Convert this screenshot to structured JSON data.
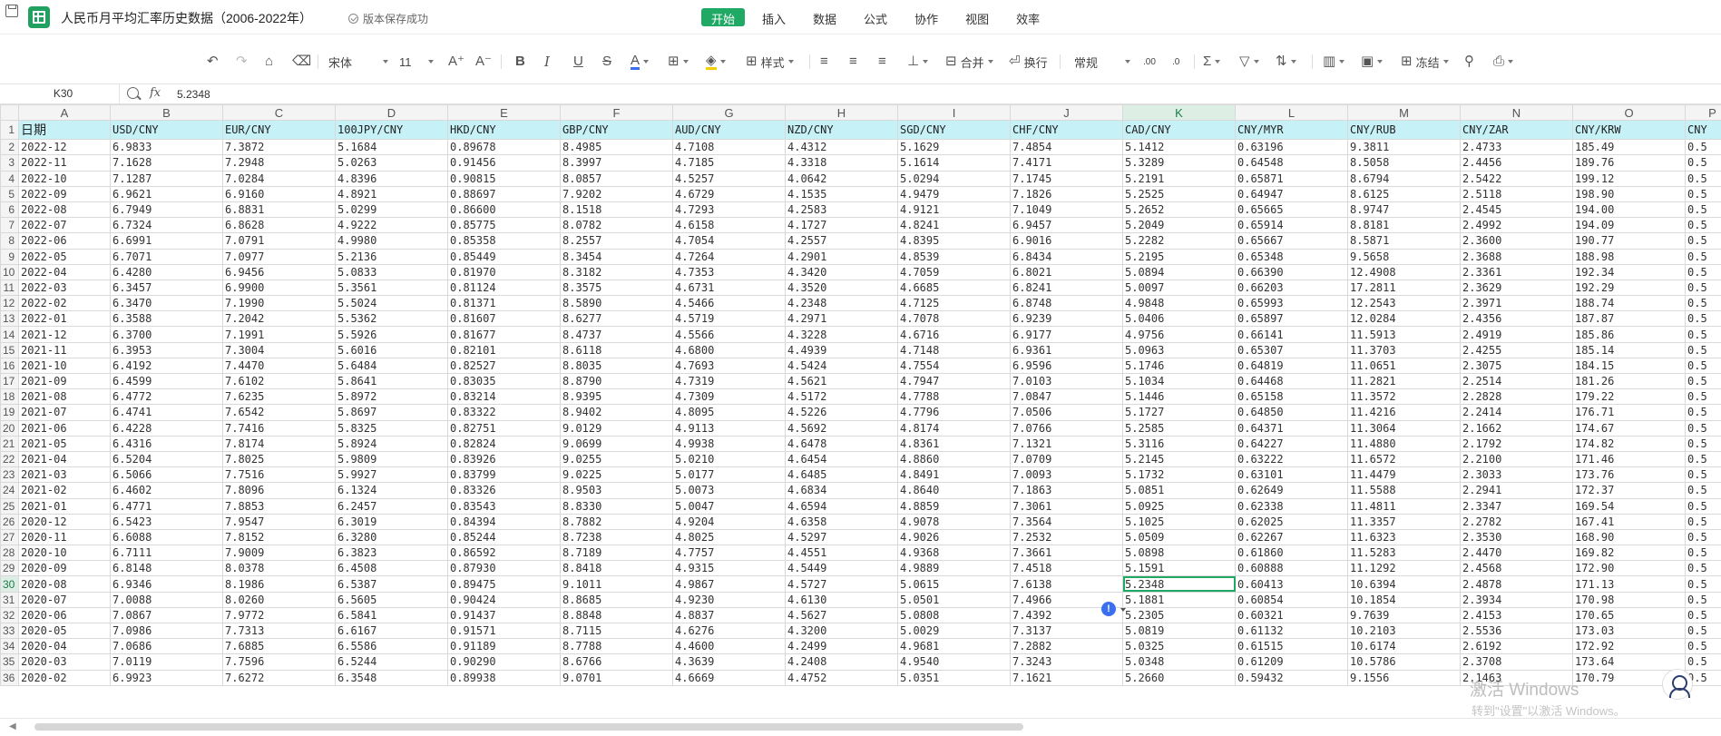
{
  "titlebar": {
    "doc_title": "人民币月平均汇率历史数据（2006-2022年）",
    "save_status": "版本保存成功",
    "menu": [
      "开始",
      "插入",
      "数据",
      "公式",
      "协作",
      "视图",
      "效率"
    ],
    "active_menu": "开始"
  },
  "toolbar": {
    "font_name": "宋体",
    "font_size": "11",
    "style_label": "样式",
    "merge_label": "合并",
    "wrap_label": "换行",
    "number_format": "常规",
    "freeze_label": "冻结",
    "decimal_add": ".00",
    "decimal_remove": ".0"
  },
  "formula": {
    "cell_ref": "K30",
    "fx": "fx",
    "value": "5.2348"
  },
  "grid": {
    "columns": [
      "A",
      "B",
      "C",
      "D",
      "E",
      "F",
      "G",
      "H",
      "I",
      "J",
      "K",
      "L",
      "M",
      "N",
      "O",
      "P"
    ],
    "selected_column": "K",
    "selected_row": 30,
    "active_cell": {
      "row": 30,
      "col": 10
    },
    "header_row": [
      "日期",
      "USD/CNY",
      "EUR/CNY",
      "100JPY/CNY",
      "HKD/CNY",
      "GBP/CNY",
      "AUD/CNY",
      "NZD/CNY",
      "SGD/CNY",
      "CHF/CNY",
      "CAD/CNY",
      "CNY/MYR",
      "CNY/RUB",
      "CNY/ZAR",
      "CNY/KRW",
      "CNY"
    ],
    "rows": [
      [
        "2022-12",
        "6.9833",
        "7.3872",
        "5.1684",
        "0.89678",
        "8.4985",
        "4.7108",
        "4.4312",
        "5.1629",
        "7.4854",
        "5.1412",
        "0.63196",
        "9.3811",
        "2.4733",
        "185.49",
        "0.5"
      ],
      [
        "2022-11",
        "7.1628",
        "7.2948",
        "5.0263",
        "0.91456",
        "8.3997",
        "4.7185",
        "4.3318",
        "5.1614",
        "7.4171",
        "5.3289",
        "0.64548",
        "8.5058",
        "2.4456",
        "189.76",
        "0.5"
      ],
      [
        "2022-10",
        "7.1287",
        "7.0284",
        "4.8396",
        "0.90815",
        "8.0857",
        "4.5257",
        "4.0642",
        "5.0294",
        "7.1745",
        "5.2191",
        "0.65871",
        "8.6794",
        "2.5422",
        "199.12",
        "0.5"
      ],
      [
        "2022-09",
        "6.9621",
        "6.9160",
        "4.8921",
        "0.88697",
        "7.9202",
        "4.6729",
        "4.1535",
        "4.9479",
        "7.1826",
        "5.2525",
        "0.64947",
        "8.6125",
        "2.5118",
        "198.90",
        "0.5"
      ],
      [
        "2022-08",
        "6.7949",
        "6.8831",
        "5.0299",
        "0.86600",
        "8.1518",
        "4.7293",
        "4.2583",
        "4.9121",
        "7.1049",
        "5.2652",
        "0.65665",
        "8.9747",
        "2.4545",
        "194.00",
        "0.5"
      ],
      [
        "2022-07",
        "6.7324",
        "6.8628",
        "4.9222",
        "0.85775",
        "8.0782",
        "4.6158",
        "4.1727",
        "4.8241",
        "6.9457",
        "5.2049",
        "0.65914",
        "8.8181",
        "2.4992",
        "194.09",
        "0.5"
      ],
      [
        "2022-06",
        "6.6991",
        "7.0791",
        "4.9980",
        "0.85358",
        "8.2557",
        "4.7054",
        "4.2557",
        "4.8395",
        "6.9016",
        "5.2282",
        "0.65667",
        "8.5871",
        "2.3600",
        "190.77",
        "0.5"
      ],
      [
        "2022-05",
        "6.7071",
        "7.0977",
        "5.2136",
        "0.85449",
        "8.3454",
        "4.7264",
        "4.2901",
        "4.8539",
        "6.8434",
        "5.2195",
        "0.65348",
        "9.5658",
        "2.3688",
        "188.98",
        "0.5"
      ],
      [
        "2022-04",
        "6.4280",
        "6.9456",
        "5.0833",
        "0.81970",
        "8.3182",
        "4.7353",
        "4.3420",
        "4.7059",
        "6.8021",
        "5.0894",
        "0.66390",
        "12.4908",
        "2.3361",
        "192.34",
        "0.5"
      ],
      [
        "2022-03",
        "6.3457",
        "6.9900",
        "5.3561",
        "0.81124",
        "8.3575",
        "4.6731",
        "4.3520",
        "4.6685",
        "6.8241",
        "5.0097",
        "0.66203",
        "17.2811",
        "2.3629",
        "192.29",
        "0.5"
      ],
      [
        "2022-02",
        "6.3470",
        "7.1990",
        "5.5024",
        "0.81371",
        "8.5890",
        "4.5466",
        "4.2348",
        "4.7125",
        "6.8748",
        "4.9848",
        "0.65993",
        "12.2543",
        "2.3971",
        "188.74",
        "0.5"
      ],
      [
        "2022-01",
        "6.3588",
        "7.2042",
        "5.5362",
        "0.81607",
        "8.6277",
        "4.5719",
        "4.2971",
        "4.7078",
        "6.9239",
        "5.0406",
        "0.65897",
        "12.0284",
        "2.4356",
        "187.87",
        "0.5"
      ],
      [
        "2021-12",
        "6.3700",
        "7.1991",
        "5.5926",
        "0.81677",
        "8.4737",
        "4.5566",
        "4.3228",
        "4.6716",
        "6.9177",
        "4.9756",
        "0.66141",
        "11.5913",
        "2.4919",
        "185.86",
        "0.5"
      ],
      [
        "2021-11",
        "6.3953",
        "7.3004",
        "5.6016",
        "0.82101",
        "8.6118",
        "4.6800",
        "4.4939",
        "4.7148",
        "6.9361",
        "5.0963",
        "0.65307",
        "11.3703",
        "2.4255",
        "185.14",
        "0.5"
      ],
      [
        "2021-10",
        "6.4192",
        "7.4470",
        "5.6484",
        "0.82527",
        "8.8035",
        "4.7693",
        "4.5424",
        "4.7554",
        "6.9596",
        "5.1746",
        "0.64819",
        "11.0651",
        "2.3075",
        "184.15",
        "0.5"
      ],
      [
        "2021-09",
        "6.4599",
        "7.6102",
        "5.8641",
        "0.83035",
        "8.8790",
        "4.7319",
        "4.5621",
        "4.7947",
        "7.0103",
        "5.1034",
        "0.64468",
        "11.2821",
        "2.2514",
        "181.26",
        "0.5"
      ],
      [
        "2021-08",
        "6.4772",
        "7.6235",
        "5.8972",
        "0.83214",
        "8.9395",
        "4.7309",
        "4.5172",
        "4.7788",
        "7.0847",
        "5.1446",
        "0.65158",
        "11.3572",
        "2.2828",
        "179.22",
        "0.5"
      ],
      [
        "2021-07",
        "6.4741",
        "7.6542",
        "5.8697",
        "0.83322",
        "8.9402",
        "4.8095",
        "4.5226",
        "4.7796",
        "7.0506",
        "5.1727",
        "0.64850",
        "11.4216",
        "2.2414",
        "176.71",
        "0.5"
      ],
      [
        "2021-06",
        "6.4228",
        "7.7416",
        "5.8325",
        "0.82751",
        "9.0129",
        "4.9113",
        "4.5692",
        "4.8174",
        "7.0766",
        "5.2585",
        "0.64371",
        "11.3064",
        "2.1662",
        "174.67",
        "0.5"
      ],
      [
        "2021-05",
        "6.4316",
        "7.8174",
        "5.8924",
        "0.82824",
        "9.0699",
        "4.9938",
        "4.6478",
        "4.8361",
        "7.1321",
        "5.3116",
        "0.64227",
        "11.4880",
        "2.1792",
        "174.82",
        "0.5"
      ],
      [
        "2021-04",
        "6.5204",
        "7.8025",
        "5.9809",
        "0.83926",
        "9.0255",
        "5.0210",
        "4.6454",
        "4.8860",
        "7.0709",
        "5.2145",
        "0.63222",
        "11.6572",
        "2.2100",
        "171.46",
        "0.5"
      ],
      [
        "2021-03",
        "6.5066",
        "7.7516",
        "5.9927",
        "0.83799",
        "9.0225",
        "5.0177",
        "4.6485",
        "4.8491",
        "7.0093",
        "5.1732",
        "0.63101",
        "11.4479",
        "2.3033",
        "173.76",
        "0.5"
      ],
      [
        "2021-02",
        "6.4602",
        "7.8096",
        "6.1324",
        "0.83326",
        "8.9503",
        "5.0073",
        "4.6834",
        "4.8640",
        "7.1863",
        "5.0851",
        "0.62649",
        "11.5588",
        "2.2941",
        "172.37",
        "0.5"
      ],
      [
        "2021-01",
        "6.4771",
        "7.8853",
        "6.2457",
        "0.83543",
        "8.8330",
        "5.0047",
        "4.6594",
        "4.8859",
        "7.3061",
        "5.0925",
        "0.62338",
        "11.4811",
        "2.3347",
        "169.54",
        "0.5"
      ],
      [
        "2020-12",
        "6.5423",
        "7.9547",
        "6.3019",
        "0.84394",
        "8.7882",
        "4.9204",
        "4.6358",
        "4.9078",
        "7.3564",
        "5.1025",
        "0.62025",
        "11.3357",
        "2.2782",
        "167.41",
        "0.5"
      ],
      [
        "2020-11",
        "6.6088",
        "7.8152",
        "6.3280",
        "0.85244",
        "8.7238",
        "4.8025",
        "4.5297",
        "4.9026",
        "7.2532",
        "5.0509",
        "0.62267",
        "11.6323",
        "2.3530",
        "168.90",
        "0.5"
      ],
      [
        "2020-10",
        "6.7111",
        "7.9009",
        "6.3823",
        "0.86592",
        "8.7189",
        "4.7757",
        "4.4551",
        "4.9368",
        "7.3661",
        "5.0898",
        "0.61860",
        "11.5283",
        "2.4470",
        "169.82",
        "0.5"
      ],
      [
        "2020-09",
        "6.8148",
        "8.0378",
        "6.4508",
        "0.87930",
        "8.8418",
        "4.9315",
        "4.5449",
        "4.9889",
        "7.4518",
        "5.1591",
        "0.60888",
        "11.1292",
        "2.4568",
        "172.90",
        "0.5"
      ],
      [
        "2020-08",
        "6.9346",
        "8.1986",
        "6.5387",
        "0.89475",
        "9.1011",
        "4.9867",
        "4.5727",
        "5.0615",
        "7.6138",
        "5.2348",
        "0.60413",
        "10.6394",
        "2.4878",
        "171.13",
        "0.5"
      ],
      [
        "2020-07",
        "7.0088",
        "8.0260",
        "6.5605",
        "0.90424",
        "8.8685",
        "4.9230",
        "4.6130",
        "5.0501",
        "7.4966",
        "5.1881",
        "0.60854",
        "10.1854",
        "2.3934",
        "170.98",
        "0.5"
      ],
      [
        "2020-06",
        "7.0867",
        "7.9772",
        "6.5841",
        "0.91437",
        "8.8848",
        "4.8837",
        "4.5627",
        "5.0808",
        "7.4392",
        "5.2305",
        "0.60321",
        "9.7639",
        "2.4153",
        "170.65",
        "0.5"
      ],
      [
        "2020-05",
        "7.0986",
        "7.7313",
        "6.6167",
        "0.91571",
        "8.7115",
        "4.6276",
        "4.3200",
        "5.0029",
        "7.3137",
        "5.0819",
        "0.61132",
        "10.2103",
        "2.5536",
        "173.03",
        "0.5"
      ],
      [
        "2020-04",
        "7.0686",
        "7.6885",
        "6.5586",
        "0.91189",
        "8.7788",
        "4.4600",
        "4.2499",
        "4.9681",
        "7.2882",
        "5.0325",
        "0.61515",
        "10.6174",
        "2.6192",
        "172.92",
        "0.5"
      ],
      [
        "2020-03",
        "7.0119",
        "7.7596",
        "6.5244",
        "0.90290",
        "8.6766",
        "4.3639",
        "4.2408",
        "4.9540",
        "7.3243",
        "5.0348",
        "0.61209",
        "10.5786",
        "2.3708",
        "173.64",
        "0.5"
      ],
      [
        "2020-02",
        "6.9923",
        "7.6272",
        "6.3548",
        "0.89938",
        "9.0701",
        "4.6669",
        "4.4752",
        "5.0351",
        "7.1621",
        "5.2660",
        "0.59432",
        "9.1556",
        "2.1463",
        "170.79",
        "0.5"
      ]
    ]
  },
  "watermark": {
    "line1": "激活 Windows",
    "line2": "转到\"设置\"以激活 Windows。"
  }
}
